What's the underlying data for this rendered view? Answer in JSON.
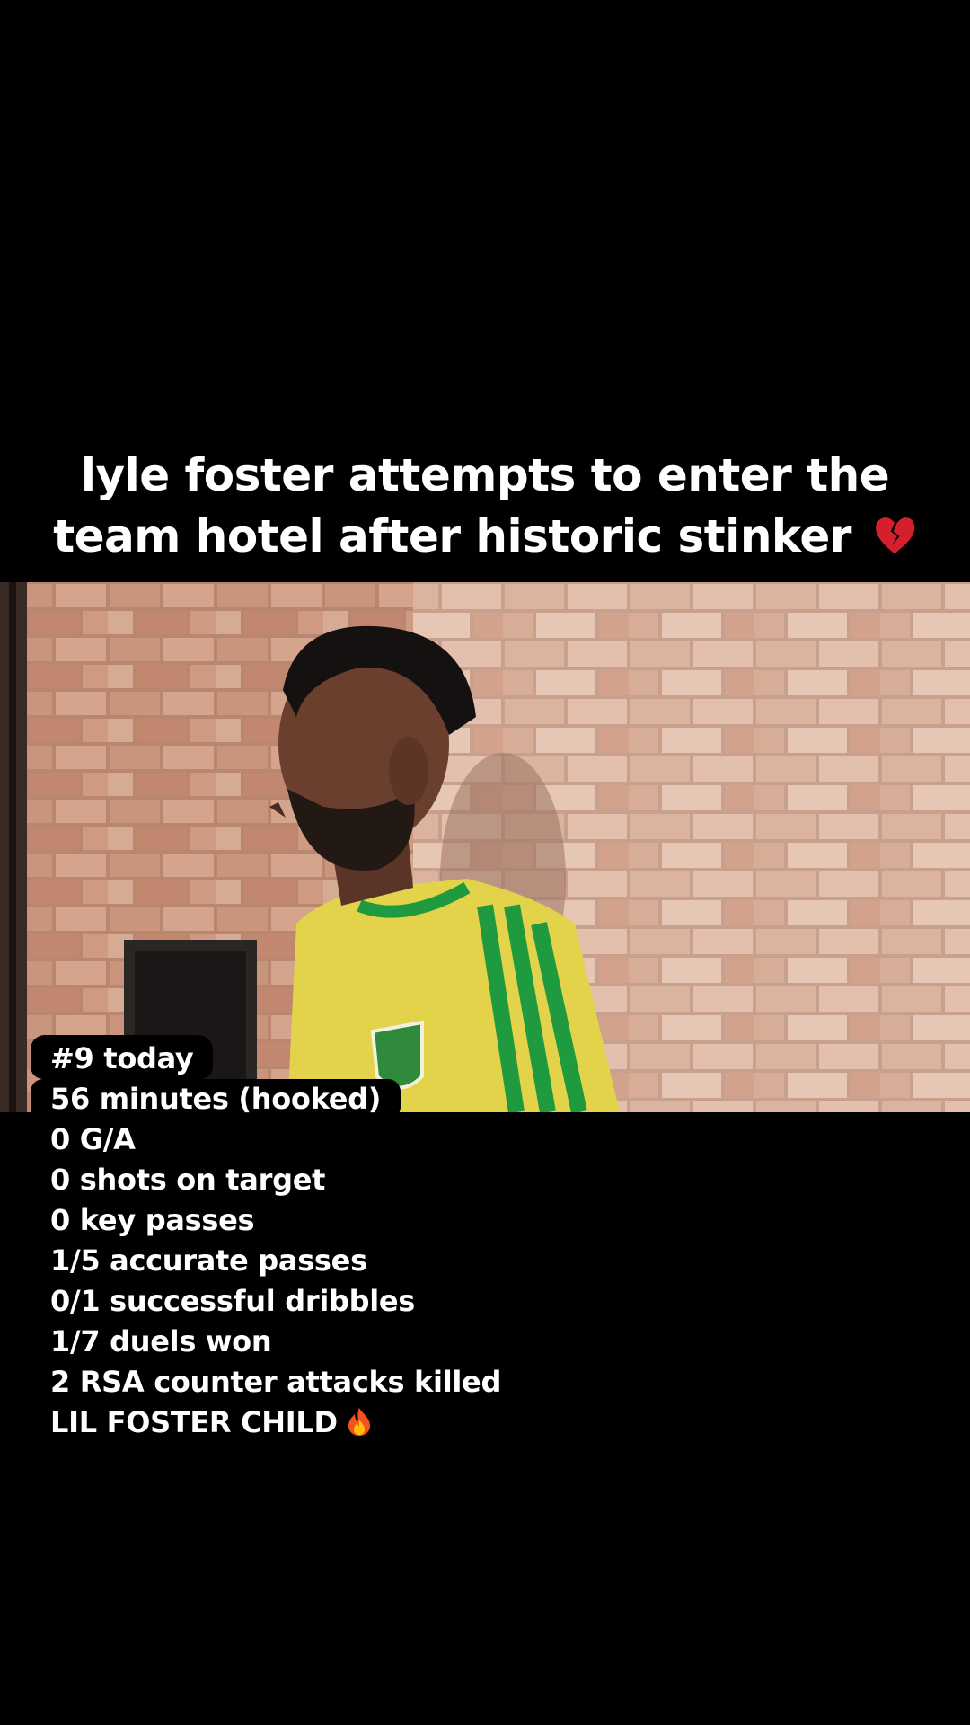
{
  "caption": {
    "line1": "lyle foster attempts to enter the",
    "line2": "team hotel after historic stinker",
    "emoji": "broken-heart-icon"
  },
  "video": {
    "description_icon": "video-frame"
  },
  "stats": {
    "lines": [
      "#9 today",
      "56 minutes (hooked)",
      "0 G/A",
      "0 shots on target",
      "0 key passes",
      "1/5 accurate passes",
      "0/1 successful dribbles",
      "1/7 duels won",
      "2 RSA counter attacks killed",
      "LIL FOSTER CHILD"
    ],
    "final_emoji": "fire-icon"
  },
  "colors": {
    "background": "#000000",
    "text": "#ffffff",
    "jersey_yellow": "#e3d34a",
    "jersey_green": "#1f9a3f"
  }
}
